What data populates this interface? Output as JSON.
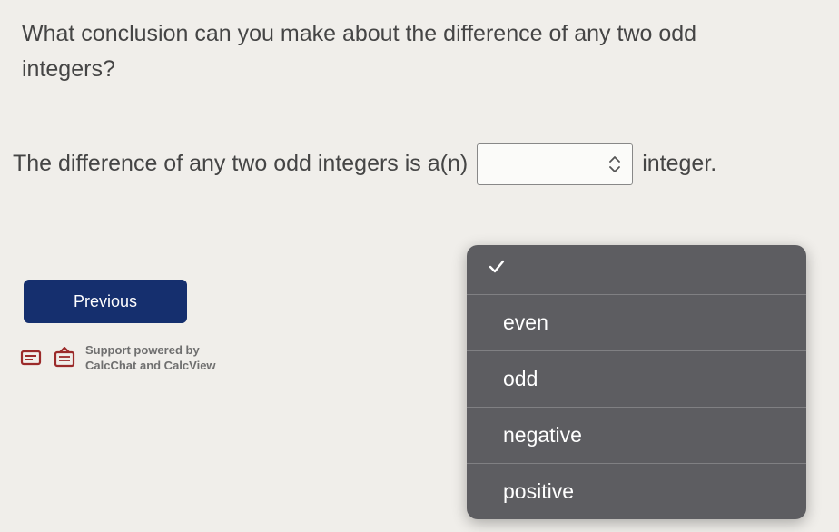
{
  "question": {
    "line1": "What conclusion can you make about the difference of any two odd",
    "line2": "integers?"
  },
  "answer": {
    "prefix": "The difference of any two odd integers is a(n)",
    "suffix": "integer."
  },
  "buttons": {
    "previous": "Previous"
  },
  "support": {
    "line1": "Support powered by",
    "line2": "CalcChat and CalcView"
  },
  "dropdown": {
    "options": [
      "even",
      "odd",
      "negative",
      "positive"
    ]
  }
}
